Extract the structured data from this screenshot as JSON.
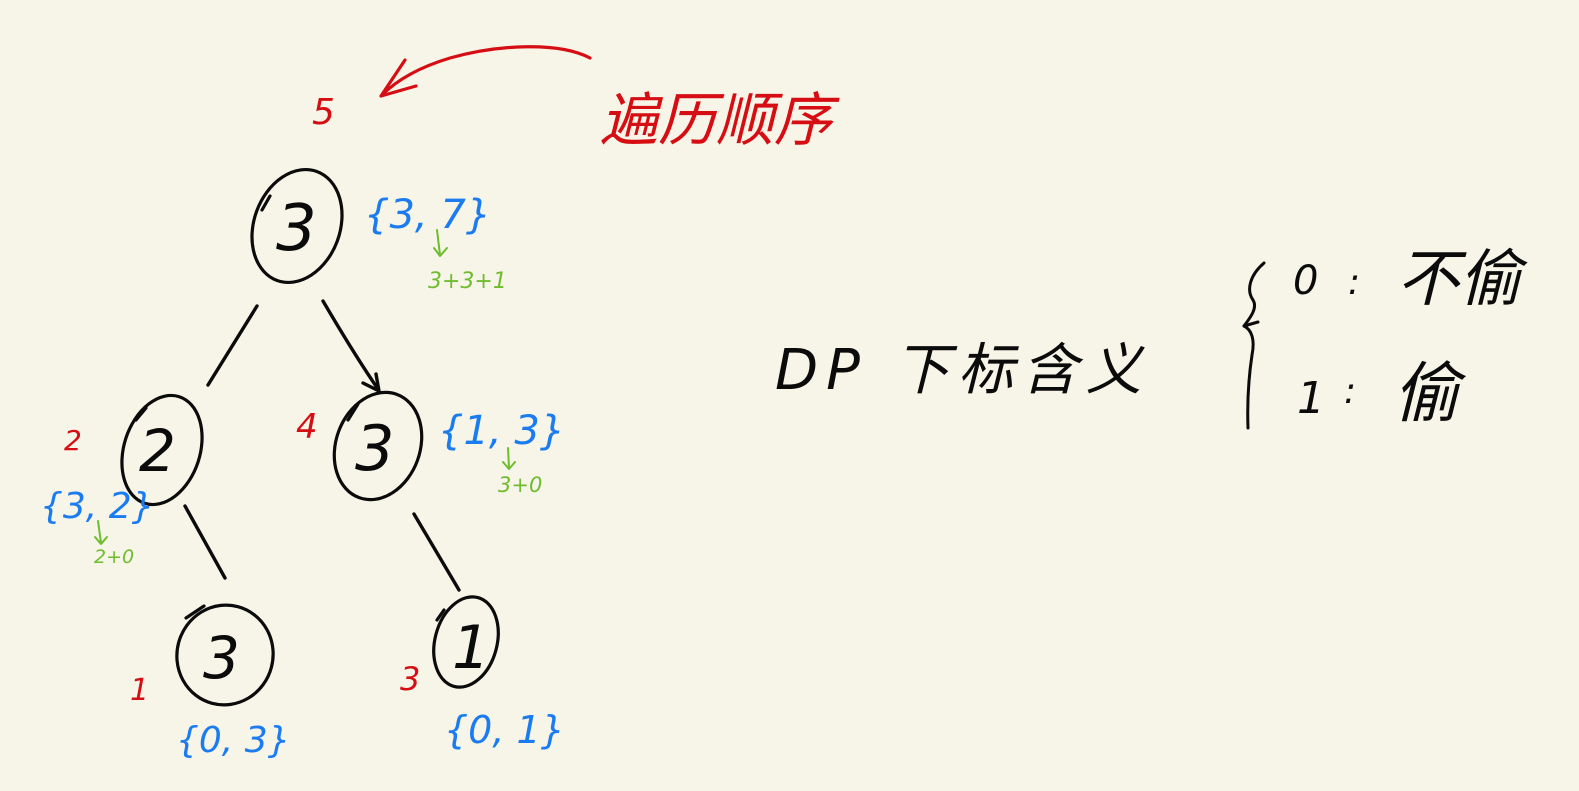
{
  "title": "遍历顺序",
  "colors": {
    "background": "#f7f4e8",
    "ink": "#0b0b0b",
    "order": "#d60d12",
    "dp": "#1a7cf0",
    "calc": "#6fbd2e"
  },
  "tree": {
    "nodes": [
      {
        "id": "root",
        "value": "3",
        "order": "5",
        "dp": "{3, 7}",
        "calc": "3+3+1"
      },
      {
        "id": "left",
        "value": "2",
        "order": "2",
        "dp": "{3, 2}",
        "calc": "2+0"
      },
      {
        "id": "right",
        "value": "3",
        "order": "4",
        "dp": "{1, 3}",
        "calc": "3+0"
      },
      {
        "id": "left-right",
        "value": "3",
        "order": "1",
        "dp": "{0, 3}",
        "calc": ""
      },
      {
        "id": "right-right",
        "value": "1",
        "order": "3",
        "dp": "{0, 1}",
        "calc": ""
      }
    ]
  },
  "legend": {
    "heading": "DP 下标含义",
    "items": [
      {
        "index": "0",
        "sep": ":",
        "meaning": "不偷"
      },
      {
        "index": "1",
        "sep": ":",
        "meaning": "偷"
      }
    ]
  }
}
